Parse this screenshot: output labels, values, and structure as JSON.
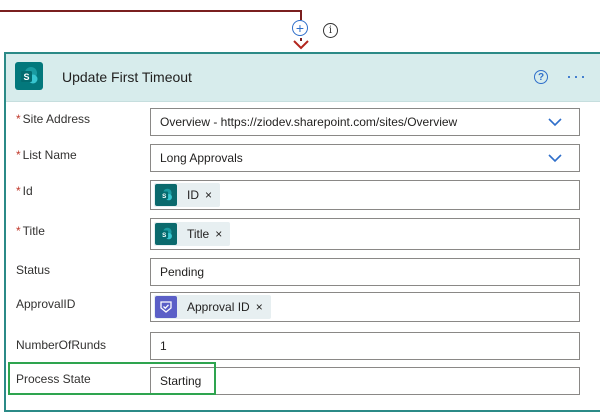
{
  "connector": {
    "add_icon": "plus-circle-icon",
    "info_icon": "info-circle-icon",
    "arrow_icon": "arrow-down-icon"
  },
  "card": {
    "title": "Update First Timeout",
    "app_icon": "sharepoint-icon",
    "help_icon": "question-circle-icon",
    "more_icon": "ellipsis-icon",
    "more_label": "···",
    "help_label": "?",
    "colors": {
      "border": "#2b8a87",
      "header_bg": "#d7ecec",
      "accent": "#2f6fca"
    }
  },
  "form": {
    "site_address": {
      "label": "Site Address",
      "required": true,
      "value": "Overview - https://ziodev.sharepoint.com/sites/Overview"
    },
    "list_name": {
      "label": "List Name",
      "required": true,
      "value": "Long Approvals"
    },
    "id": {
      "label": "Id",
      "required": true,
      "token": "ID",
      "token_source": "sharepoint"
    },
    "title": {
      "label": "Title",
      "required": true,
      "token": "Title",
      "token_source": "sharepoint"
    },
    "status": {
      "label": "Status",
      "value": "Pending"
    },
    "approval_id": {
      "label": "ApprovalID",
      "token": "Approval ID",
      "token_source": "approvals"
    },
    "number_of_runds": {
      "label": "NumberOfRunds",
      "value": "1"
    },
    "process_state": {
      "label": "Process State",
      "value": "Starting"
    }
  },
  "required_mark": "*",
  "remove_glyph": "×"
}
